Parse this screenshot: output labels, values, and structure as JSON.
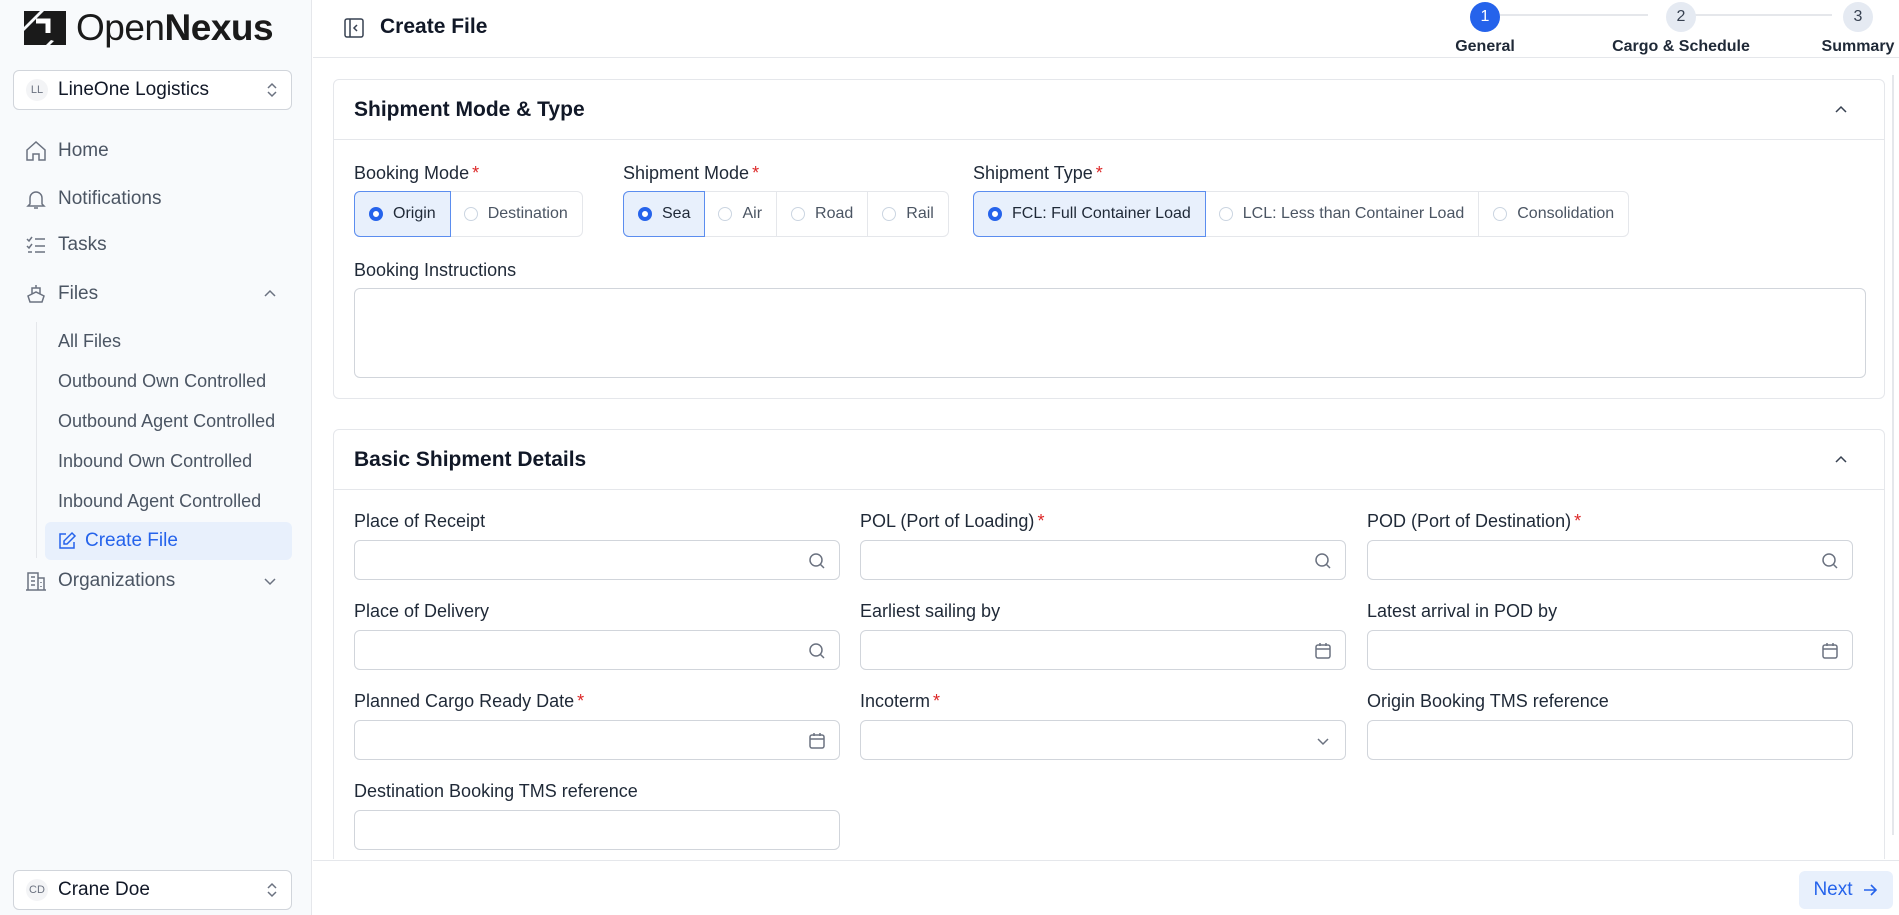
{
  "brand": {
    "name_light": "Open",
    "name_bold": "Nexus"
  },
  "org_selector": {
    "initials": "LL",
    "name": "LineOne Logistics"
  },
  "nav": {
    "home": "Home",
    "notifications": "Notifications",
    "tasks": "Tasks",
    "files": "Files",
    "files_sub": [
      "All Files",
      "Outbound Own Controlled",
      "Outbound Agent Controlled",
      "Inbound Own Controlled",
      "Inbound Agent Controlled"
    ],
    "create_file": "Create File",
    "organizations": "Organizations"
  },
  "user_selector": {
    "initials": "CD",
    "name": "Crane Doe"
  },
  "header": {
    "title": "Create File"
  },
  "steps": [
    {
      "number": "1",
      "label": "General",
      "state": "active"
    },
    {
      "number": "2",
      "label": "Cargo & Schedule",
      "state": "idle"
    },
    {
      "number": "3",
      "label": "Summary",
      "state": "idle"
    }
  ],
  "section1": {
    "title": "Shipment Mode & Type",
    "booking_mode": {
      "label": "Booking Mode",
      "options": [
        "Origin",
        "Destination"
      ],
      "selected": "Origin"
    },
    "shipment_mode": {
      "label": "Shipment Mode",
      "options": [
        "Sea",
        "Air",
        "Road",
        "Rail"
      ],
      "selected": "Sea"
    },
    "shipment_type": {
      "label": "Shipment Type",
      "options": [
        "FCL: Full Container Load",
        "LCL: Less than Container Load",
        "Consolidation"
      ],
      "selected": "FCL: Full Container Load"
    },
    "booking_instructions": {
      "label": "Booking Instructions",
      "value": ""
    }
  },
  "section2": {
    "title": "Basic Shipment Details",
    "place_of_receipt": "Place of Receipt",
    "pol": "POL (Port of Loading)",
    "pod": "POD (Port of Destination)",
    "place_of_delivery": "Place of Delivery",
    "earliest_sailing": "Earliest sailing by",
    "latest_arrival": "Latest arrival in POD by",
    "cargo_ready": "Planned Cargo Ready Date",
    "incoterm": "Incoterm",
    "origin_tms": "Origin Booking TMS reference",
    "dest_tms": "Destination Booking TMS reference"
  },
  "footer": {
    "next": "Next"
  },
  "colors": {
    "accent": "#2563eb",
    "accent_bg": "#e8f0fc",
    "required": "#dc2626"
  }
}
